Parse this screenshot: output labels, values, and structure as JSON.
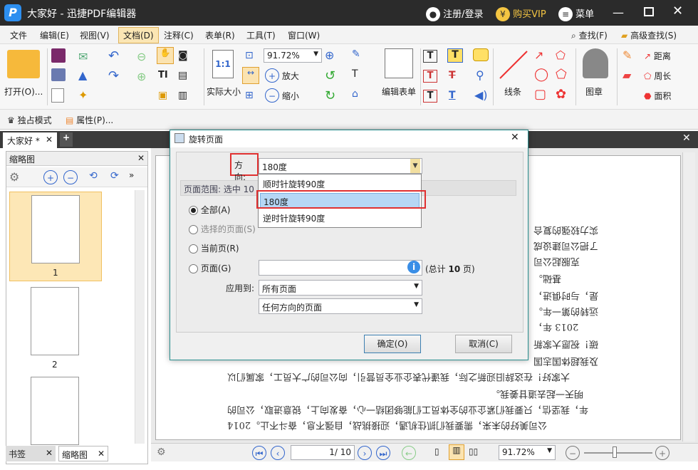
{
  "app": {
    "tab_title": "大家好",
    "window_title": "大家好 - 迅捷PDF编辑器",
    "login": "注册/登录",
    "vip": "购买VIP",
    "menu": "菜单"
  },
  "menubar": [
    "文件",
    "编辑(E)",
    "视图(V)",
    "文档(D)",
    "注释(C)",
    "表单(R)",
    "工具(T)",
    "窗口(W)"
  ],
  "menubar_right": {
    "find": "查找(F)",
    "adv_find": "高级查找(S)"
  },
  "ribbon": {
    "open": "打开(O)...",
    "actual_size": "实际大小",
    "zoom": "91.72%",
    "zoom_in": "放大",
    "zoom_out": "缩小",
    "edit_form": "编辑表单",
    "lines": "线条",
    "stamp": "图章",
    "distance": "距离",
    "perimeter": "周长",
    "area": "面积"
  },
  "toolrow2": {
    "exclusive": "独占模式",
    "properties": "属性(P)..."
  },
  "doc_tab": {
    "label": "大家好 *"
  },
  "thumbs": {
    "header": "缩略图",
    "page1": "1",
    "page2": "2"
  },
  "bottom_tabs": {
    "bookmarks": "书签",
    "thumbnails": "缩略图"
  },
  "statusbar": {
    "page_input": "1",
    "page_total": "/ 10",
    "zoom": "91.72%"
  },
  "document_lines": [
    "实力较强的复合",
    "了把公司建设成",
    "克服起公司",
    "基础。",
    "是，与时俱进，",
    "远转的第一年。",
    "2013 年，",
    "碳！祝愿大家新",
    "及我超体国志国",
    "大家好！在这辞旧迎新之际，我谨代表企业全员营引，向公司的广大员工，家属们以",
    "明天一起去道甘姜我。",
    "年，我坚信，只要我们紧企业的全体员工们能够团结一心，奋发向上，锐意进取，公司的",
    "公司美好的未来，需要我们抓住机遇，迎接挑战，自强不息，奋斗不止。2014"
  ],
  "dialog": {
    "title": "旋转页面",
    "direction_label": "方向:",
    "direction_value": "180度",
    "range_label": "页面范围: 选中 10",
    "options": [
      "顺时针旋转90度",
      "180度",
      "逆时针旋转90度"
    ],
    "radio_all": "全部(A)",
    "radio_selected": "选择的页面(S)",
    "radio_current": "当前页(R)",
    "radio_pages": "页面(G)",
    "total_prefix": "(总计",
    "total_count": "10",
    "total_suffix": "页)",
    "apply_to_label": "应用到:",
    "apply_to_value": "所有页面",
    "orientation_value": "任何方向的页面",
    "ok": "确定(O)",
    "cancel": "取消(C)"
  }
}
